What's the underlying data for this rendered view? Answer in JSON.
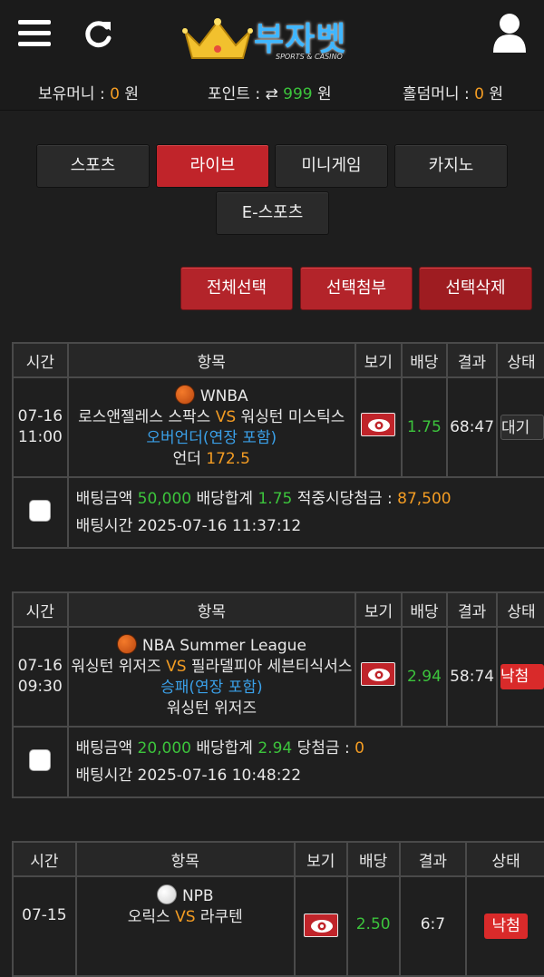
{
  "header": {
    "logo_text": "부자벳",
    "logo_sub": "SPORTS & CASINO"
  },
  "balances": {
    "holding_label": "보유머니 :",
    "holding_value": "0",
    "holding_unit": "원",
    "points_label": "포인트 :",
    "points_value": "999",
    "points_unit": "원",
    "holdem_label": "홀덤머니 :",
    "holdem_value": "0",
    "holdem_unit": "원"
  },
  "menu": {
    "sports": "스포츠",
    "live": "라이브",
    "minigame": "미니게임",
    "casino": "카지노",
    "esports": "E-스포츠"
  },
  "actions": {
    "select_all": "전체선택",
    "attach": "선택첨부",
    "delete": "선택삭제"
  },
  "columns": {
    "time": "시간",
    "item": "항목",
    "view": "보기",
    "odds": "배당",
    "result": "결과",
    "status": "상태"
  },
  "bets": [
    {
      "date": "07-16",
      "time": "11:00",
      "league": "WNBA",
      "home": "로스앤젤레스 스팍스",
      "vs": "VS",
      "away": "워싱턴 미스틱스",
      "market": "오버언더(연장 포함)",
      "pick_label": "언더",
      "pick_value": "172.5",
      "odds": "1.75",
      "result": "68:47",
      "status": "대기",
      "amount_label": "배팅금액",
      "amount": "50,000",
      "total_odds_label": "배당합계",
      "total_odds": "1.75",
      "payout_label": "적중시당첨금 :",
      "payout": "87,500",
      "bet_time_label": "배팅시간",
      "bet_time": "2025-07-16 11:37:12"
    },
    {
      "date": "07-16",
      "time": "09:30",
      "league": "NBA Summer League",
      "home": "워싱턴 위저즈",
      "vs": "VS",
      "away": "필라델피아 세븐티식서스",
      "market": "승패(연장 포함)",
      "pick_label": "워싱턴 위저즈",
      "odds": "2.94",
      "result": "58:74",
      "status": "낙첨",
      "amount_label": "배팅금액",
      "amount": "20,000",
      "total_odds_label": "배당합계",
      "total_odds": "2.94",
      "payout_label": "당첨금 :",
      "payout": "0",
      "bet_time_label": "배팅시간",
      "bet_time": "2025-07-16 10:48:22"
    },
    {
      "date": "07-15",
      "league": "NPB",
      "home": "오릭스",
      "vs": "VS",
      "away": "라쿠텐",
      "odds": "2.50",
      "result": "6:7",
      "status": "낙첨"
    }
  ],
  "colors": {
    "accent_red": "#c0242a",
    "highlight_orange": "#f39c23",
    "odds_green": "#3cc43c",
    "market_blue": "#3aa0e8"
  }
}
